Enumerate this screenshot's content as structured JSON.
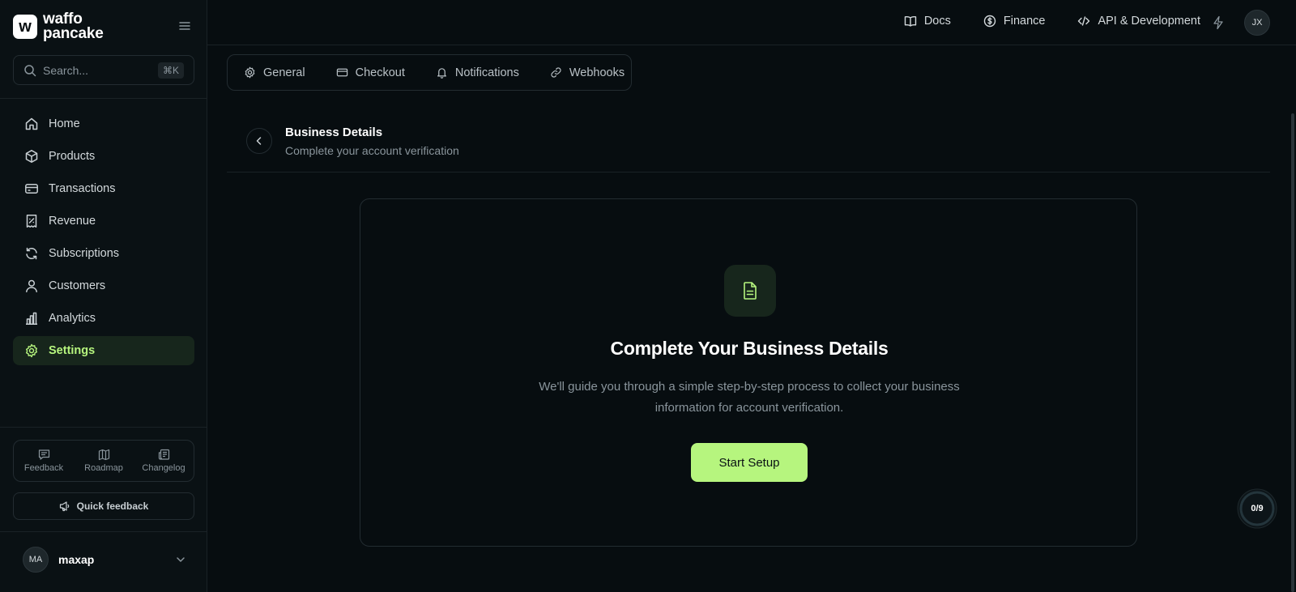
{
  "brand": {
    "logo_mark": "w",
    "name_line1": "waffo",
    "name_line2": "pancake"
  },
  "search": {
    "placeholder": "Search...",
    "shortcut": "⌘K"
  },
  "sidebar": {
    "items": [
      {
        "label": "Home",
        "icon": "home-icon"
      },
      {
        "label": "Products",
        "icon": "box-icon"
      },
      {
        "label": "Transactions",
        "icon": "credit-card-icon"
      },
      {
        "label": "Revenue",
        "icon": "receipt-icon"
      },
      {
        "label": "Subscriptions",
        "icon": "refresh-icon"
      },
      {
        "label": "Customers",
        "icon": "user-icon"
      },
      {
        "label": "Analytics",
        "icon": "bar-chart-icon"
      },
      {
        "label": "Settings",
        "icon": "gear-icon",
        "active": true
      }
    ],
    "bottom_links": [
      {
        "label": "Feedback",
        "icon": "message-icon"
      },
      {
        "label": "Roadmap",
        "icon": "map-icon"
      },
      {
        "label": "Changelog",
        "icon": "newspaper-icon"
      }
    ],
    "quick_feedback": "Quick feedback",
    "user": {
      "initials": "MA",
      "name": "maxap"
    }
  },
  "header": {
    "links": [
      {
        "label": "Docs",
        "icon": "book-icon"
      },
      {
        "label": "Finance",
        "icon": "dollar-circle-icon"
      },
      {
        "label": "API & Development",
        "icon": "code-icon"
      }
    ],
    "avatar_initials": "JX"
  },
  "tabs": [
    {
      "label": "General",
      "icon": "gear-icon"
    },
    {
      "label": "Checkout",
      "icon": "card-icon"
    },
    {
      "label": "Notifications",
      "icon": "bell-icon"
    },
    {
      "label": "Webhooks",
      "icon": "link-icon"
    }
  ],
  "page": {
    "title": "Business Details",
    "subtitle": "Complete your account verification"
  },
  "card": {
    "title": "Complete Your Business Details",
    "description": "We'll guide you through a simple step-by-step process to collect your business information for account verification.",
    "button": "Start Setup"
  },
  "progress": {
    "label": "0/9",
    "completed": 0,
    "total": 9
  },
  "colors": {
    "accent": "#b6f57e",
    "background": "#070d10",
    "active_bg": "#17261c"
  }
}
